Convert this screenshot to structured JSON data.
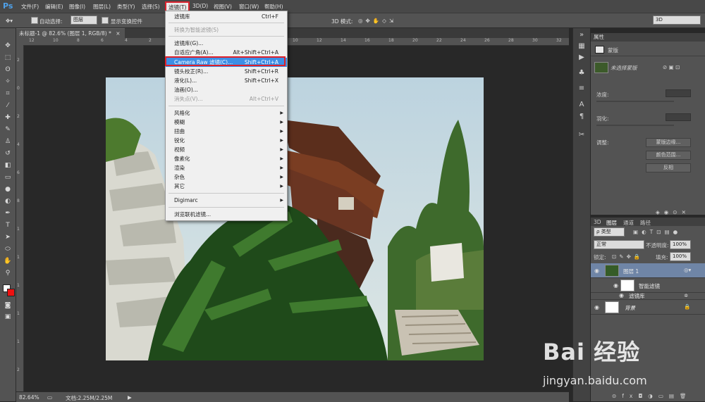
{
  "menubar": {
    "logo": "Ps",
    "items": [
      "文件(F)",
      "编辑(E)",
      "图像(I)",
      "图层(L)",
      "类型(Y)",
      "选择(S)",
      "滤镜(T)",
      "3D(D)",
      "视图(V)",
      "窗口(W)",
      "帮助(H)"
    ]
  },
  "options": {
    "auto_select": "自动选择:",
    "auto_select_value": "图层",
    "show_transform": "显示变换控件",
    "mode_3d": "3D 模式:",
    "workspace": "3D"
  },
  "document": {
    "tab": "未标题-1 @ 82.6% (图层 1, RGB/8) *",
    "close": "×"
  },
  "ruler_top": [
    "12",
    "10",
    "8",
    "6",
    "4",
    "2",
    "0",
    "2",
    "4",
    "6",
    "8",
    "10",
    "12",
    "14",
    "16",
    "18",
    "20",
    "22",
    "24",
    "26",
    "28",
    "30",
    "32"
  ],
  "ruler_left": [
    "2",
    "0",
    "2",
    "4",
    "6",
    "8",
    "1",
    "1",
    "1",
    "1",
    "1",
    "2"
  ],
  "status": {
    "zoom": "82.64%",
    "doc": "文档:2.25M/2.25M"
  },
  "filter_menu": {
    "items": [
      {
        "label": "滤镜库",
        "shortcut": "Ctrl+F",
        "disabled": false,
        "arrow": false
      },
      {
        "sep": true
      },
      {
        "label": "转换为智能滤镜(S)",
        "shortcut": "",
        "disabled": true,
        "arrow": false
      },
      {
        "sep": true
      },
      {
        "label": "滤镜库(G)...",
        "shortcut": "",
        "disabled": false,
        "arrow": false
      },
      {
        "label": "自适应广角(A)...",
        "shortcut": "Alt+Shift+Ctrl+A",
        "disabled": false,
        "arrow": false
      },
      {
        "label": "Camera Raw 滤镜(C)...",
        "shortcut": "Shift+Ctrl+A",
        "disabled": false,
        "arrow": false,
        "highlighted": true
      },
      {
        "label": "镜头校正(R)...",
        "shortcut": "Shift+Ctrl+R",
        "disabled": false,
        "arrow": false
      },
      {
        "label": "液化(L)...",
        "shortcut": "Shift+Ctrl+X",
        "disabled": false,
        "arrow": false
      },
      {
        "label": "油画(O)...",
        "shortcut": "",
        "disabled": false,
        "arrow": false
      },
      {
        "label": "消失点(V)...",
        "shortcut": "Alt+Ctrl+V",
        "disabled": true,
        "arrow": false
      },
      {
        "sep": true
      },
      {
        "label": "风格化",
        "shortcut": "",
        "disabled": false,
        "arrow": true
      },
      {
        "label": "模糊",
        "shortcut": "",
        "disabled": false,
        "arrow": true
      },
      {
        "label": "扭曲",
        "shortcut": "",
        "disabled": false,
        "arrow": true
      },
      {
        "label": "锐化",
        "shortcut": "",
        "disabled": false,
        "arrow": true
      },
      {
        "label": "视频",
        "shortcut": "",
        "disabled": false,
        "arrow": true
      },
      {
        "label": "像素化",
        "shortcut": "",
        "disabled": false,
        "arrow": true
      },
      {
        "label": "渲染",
        "shortcut": "",
        "disabled": false,
        "arrow": true
      },
      {
        "label": "杂色",
        "shortcut": "",
        "disabled": false,
        "arrow": true
      },
      {
        "label": "其它",
        "shortcut": "",
        "disabled": false,
        "arrow": true
      },
      {
        "sep": true
      },
      {
        "label": "Digimarc",
        "shortcut": "",
        "disabled": false,
        "arrow": true
      },
      {
        "sep": true
      },
      {
        "label": "浏览联机滤镜...",
        "shortcut": "",
        "disabled": false,
        "arrow": false
      }
    ]
  },
  "properties": {
    "title": "属性",
    "section": "蒙版",
    "mask_label": "未选择蒙版",
    "density": "浓度:",
    "feather": "羽化:",
    "adjust": "调整:",
    "btn_mask_edge": "蒙版边缘...",
    "btn_color_range": "颜色范围...",
    "btn_invert": "反相"
  },
  "layers": {
    "tabs": [
      "3D",
      "图层",
      "通道",
      "路径"
    ],
    "kind": "类型",
    "blend": "正常",
    "opacity_label": "不透明度:",
    "opacity": "100%",
    "lock_label": "锁定:",
    "fill_label": "填充:",
    "fill": "100%",
    "rows": [
      {
        "name": "图层 1",
        "selected": true
      },
      {
        "name": "智能滤镜",
        "selected": false
      },
      {
        "name": "滤镜库",
        "selected": false
      },
      {
        "name": "背景",
        "selected": false
      }
    ]
  },
  "watermark": {
    "brand": "Bai 经验",
    "url": "jingyan.baidu.com"
  },
  "colors": {
    "highlight": "#3d8fe5",
    "callout": "#e0202a",
    "app_bg": "#282828",
    "panel": "#535353"
  }
}
